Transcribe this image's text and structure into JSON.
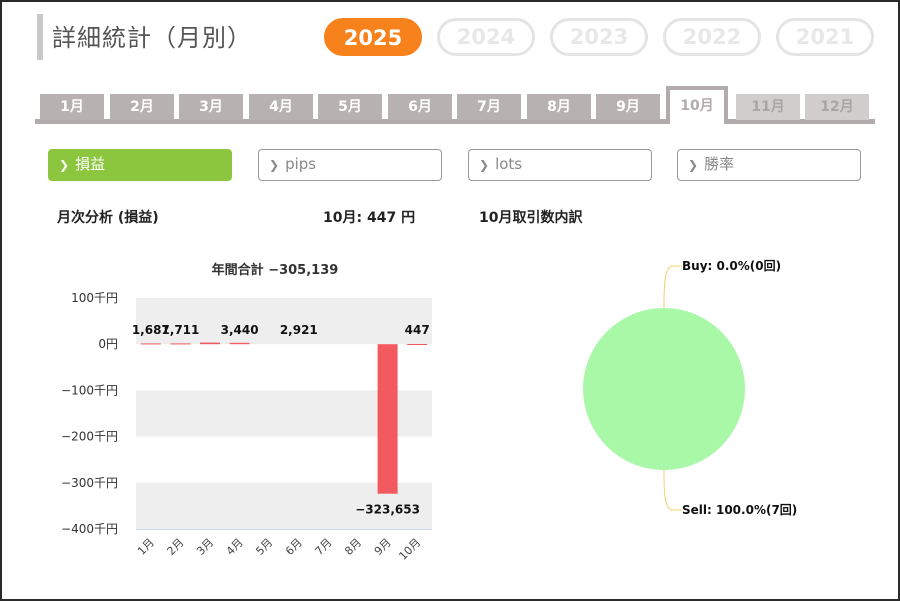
{
  "header": {
    "title": "詳細統計（月別）",
    "years": [
      {
        "label": "2025",
        "active": true
      },
      {
        "label": "2024",
        "active": false
      },
      {
        "label": "2023",
        "active": false
      },
      {
        "label": "2022",
        "active": false
      },
      {
        "label": "2021",
        "active": false
      }
    ]
  },
  "month_tabs": [
    {
      "label": "1月",
      "state": "normal"
    },
    {
      "label": "2月",
      "state": "normal"
    },
    {
      "label": "3月",
      "state": "normal"
    },
    {
      "label": "4月",
      "state": "normal"
    },
    {
      "label": "5月",
      "state": "normal"
    },
    {
      "label": "6月",
      "state": "normal"
    },
    {
      "label": "7月",
      "state": "normal"
    },
    {
      "label": "8月",
      "state": "normal"
    },
    {
      "label": "9月",
      "state": "normal"
    },
    {
      "label": "10月",
      "state": "active"
    },
    {
      "label": "11月",
      "state": "disabled"
    },
    {
      "label": "12月",
      "state": "disabled"
    }
  ],
  "metric_tabs": [
    {
      "label": "損益",
      "active": true
    },
    {
      "label": "pips",
      "active": false
    },
    {
      "label": "lots",
      "active": false
    },
    {
      "label": "勝率",
      "active": false
    }
  ],
  "section": {
    "monthly_title": "月次分析 (損益)",
    "current_month_prefix": "10月:",
    "current_month_value": "447 円",
    "breakdown_title": "10月取引数内訳"
  },
  "colors": {
    "accent": "#f7811a",
    "active_metric": "#8cc63f",
    "bar_negative": "#f25a5f",
    "pie_fill": "#a8f8a8",
    "connector": "#f3d26a"
  },
  "chart_data": [
    {
      "type": "bar",
      "title": "年間合計 −305,139",
      "categories": [
        "1月",
        "2月",
        "3月",
        "4月",
        "5月",
        "6月",
        "7月",
        "8月",
        "9月",
        "10月"
      ],
      "values": [
        1687,
        1711,
        3440,
        2921,
        0,
        0,
        0,
        0,
        -323653,
        447
      ],
      "data_labels": [
        {
          "index": 0,
          "text": "1,687"
        },
        {
          "index": 1,
          "text": "1,711"
        },
        {
          "index": 3,
          "text": "3,440"
        },
        {
          "index": 5,
          "text": "2,921"
        },
        {
          "index": 8,
          "text": "−323,653"
        },
        {
          "index": 9,
          "text": "447"
        }
      ],
      "yticks": [
        {
          "value": 100000,
          "label": "100千円"
        },
        {
          "value": 0,
          "label": "0円"
        },
        {
          "value": -100000,
          "label": "−100千円"
        },
        {
          "value": -200000,
          "label": "−200千円"
        },
        {
          "value": -300000,
          "label": "−300千円"
        },
        {
          "value": -400000,
          "label": "−400千円"
        }
      ],
      "ylim": [
        -400000,
        100000
      ],
      "grid": "alternating bands"
    },
    {
      "type": "pie",
      "slices": [
        {
          "label": "Buy: 0.0%(0回)",
          "value": 0.0,
          "count": 0
        },
        {
          "label": "Sell: 100.0%(7回)",
          "value": 100.0,
          "count": 7
        }
      ]
    }
  ]
}
